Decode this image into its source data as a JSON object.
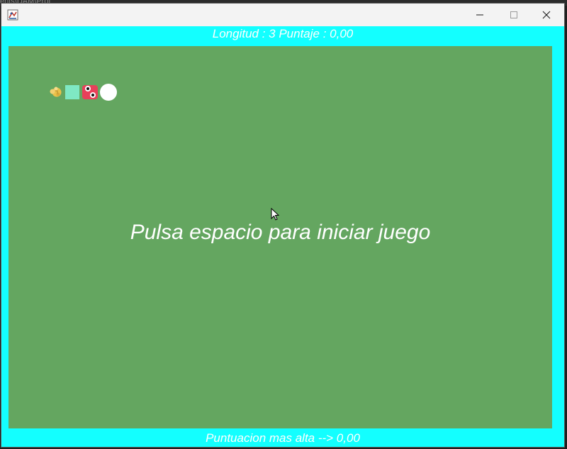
{
  "background": {
    "text": "ents\\DAM\\Prot"
  },
  "window": {
    "icon": "java-app-icon",
    "controls": {
      "minimize_icon": "minimize-icon",
      "maximize_icon": "maximize-icon",
      "close_icon": "close-icon"
    }
  },
  "game": {
    "status_text": "Longitud : 3 Puntaje : 0,00",
    "start_message": "Pulsa espacio para iniciar juego",
    "high_score_text": "Puntuacion mas alta --> 0,00",
    "colors": {
      "frame": "#13ffff",
      "board": "#64a660",
      "text": "#ffffff",
      "snake_body": "#7fe8c4",
      "snake_head": "#e8405a",
      "food": "#e9c24a"
    },
    "icons": {
      "food": "food-icon",
      "snake_body": "snake-body-segment",
      "snake_head": "snake-head-icon",
      "snake_tail": "snake-tail-segment",
      "cursor": "mouse-cursor-icon"
    }
  }
}
